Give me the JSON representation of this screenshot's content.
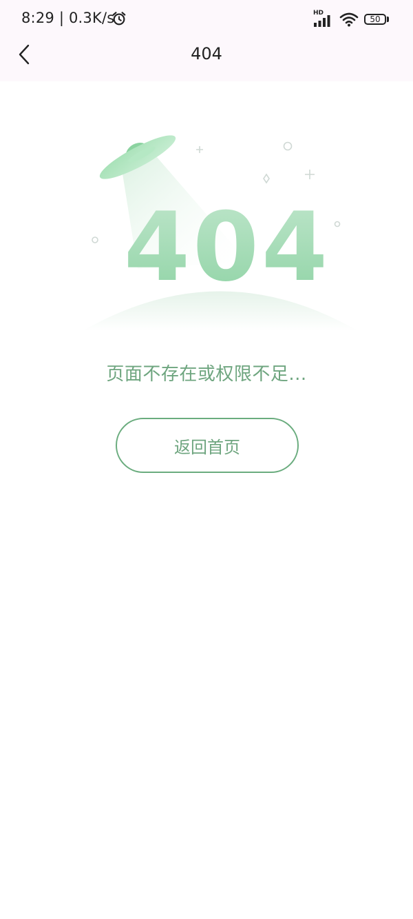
{
  "status_bar": {
    "time": "8:29 | 0.3K/s",
    "network_type": "HD",
    "battery_level": "50"
  },
  "nav": {
    "title": "404"
  },
  "illustration": {
    "code_text": "404"
  },
  "message": "页面不存在或权限不足...",
  "home_button_label": "返回首页",
  "colors": {
    "accent_green": "#6ea57f",
    "topbar_bg": "#fdf8fc"
  }
}
